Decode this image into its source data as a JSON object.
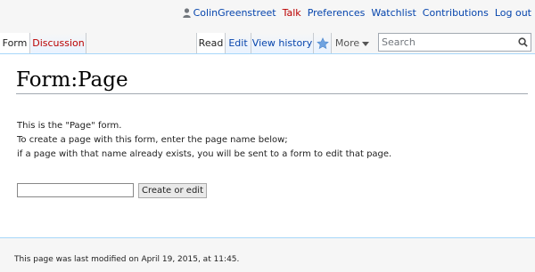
{
  "personal": {
    "username": "ColinGreenstreet",
    "talk": "Talk",
    "preferences": "Preferences",
    "watchlist": "Watchlist",
    "contributions": "Contributions",
    "logout": "Log out"
  },
  "tabs": {
    "form": "Form",
    "discussion": "Discussion",
    "read": "Read",
    "edit": "Edit",
    "view_history": "View history",
    "more": "More"
  },
  "search": {
    "placeholder": "Search",
    "value": ""
  },
  "page": {
    "title": "Form:Page",
    "lines": [
      "This is the \"Page\" form.",
      "To create a page with this form, enter the page name below;",
      "if a page with that name already exists, you will be sent to a form to edit that page."
    ],
    "input_value": "",
    "button_label": "Create or edit"
  },
  "footer": {
    "last_modified": "This page was last modified on April 19, 2015, at 11:45."
  },
  "colors": {
    "link": "#0645ad",
    "new_link": "#ba0000",
    "border": "#a7d7f9"
  },
  "icons": {
    "user": "user-icon",
    "star": "watch-star-icon",
    "search": "search-icon",
    "dropdown": "chevron-down-icon"
  }
}
